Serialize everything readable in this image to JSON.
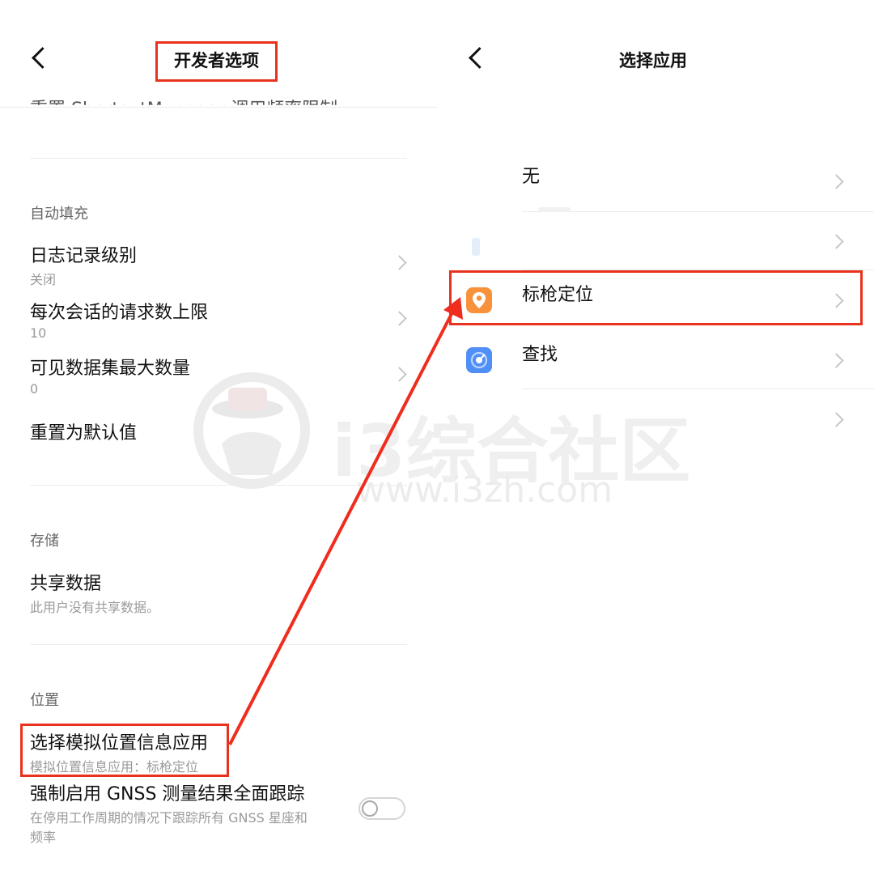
{
  "left": {
    "title": "开发者选项",
    "cut_text": "重置 ShortcutManager 调用频率限制",
    "autofill_header": "自动填充",
    "log_level": {
      "title": "日志记录级别",
      "value": "关闭"
    },
    "requests": {
      "title": "每次会话的请求数上限",
      "value": "10"
    },
    "visible_sets": {
      "title": "可见数据集最大数量",
      "value": "0"
    },
    "reset_label": "重置为默认值",
    "storage_header": "存储",
    "shared": {
      "title": "共享数据",
      "value": "此用户没有共享数据。"
    },
    "location_header": "位置",
    "mock": {
      "title": "选择模拟位置信息应用",
      "value": "模拟位置信息应用：标枪定位"
    },
    "gnss": {
      "title": "强制启用 GNSS 测量结果全面跟踪",
      "line1": "在停用工作周期的情况下跟踪所有 GNSS 星座和",
      "line2": "频率"
    }
  },
  "right": {
    "title": "选择应用",
    "items": [
      {
        "label": "无"
      },
      {
        "label": ""
      },
      {
        "label": "标枪定位",
        "icon": "location-pin-icon",
        "color": "#f7923a"
      },
      {
        "label": "查找",
        "icon": "radar-icon",
        "color": "#4f8ff7"
      },
      {
        "label": ""
      }
    ]
  },
  "watermark": {
    "brand": "i3综合社区",
    "url": "www.i3zh.com"
  },
  "colors": {
    "highlight": "#e8321e",
    "arrow": "#ef2d1e"
  }
}
